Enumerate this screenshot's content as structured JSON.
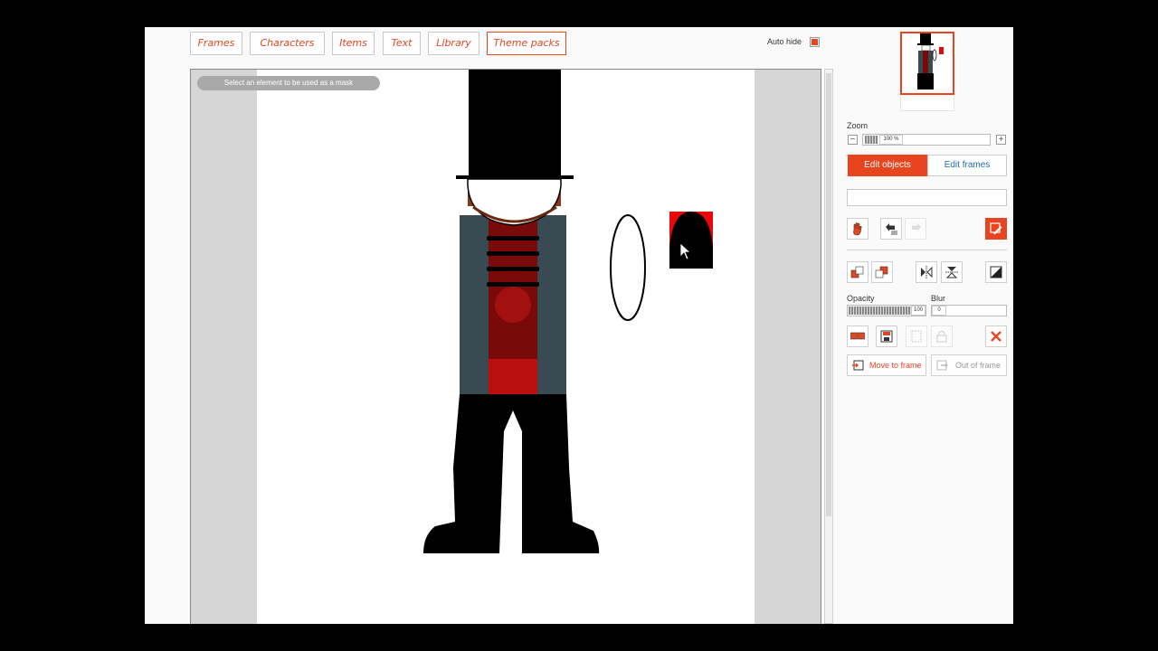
{
  "toolbar": {
    "tabs": [
      {
        "label": "Frames",
        "active": false
      },
      {
        "label": "Characters",
        "active": false
      },
      {
        "label": "Items",
        "active": false
      },
      {
        "label": "Text",
        "active": false
      },
      {
        "label": "Library",
        "active": false
      },
      {
        "label": "Theme packs",
        "active": true
      }
    ],
    "auto_hide_label": "Auto hide",
    "auto_hide_checked": true
  },
  "stage": {
    "hint": "Select an element to be used as a mask"
  },
  "panel": {
    "zoom_label": "Zoom",
    "zoom_value": "100 %",
    "edit_objects_label": "Edit objects",
    "edit_frames_label": "Edit frames",
    "object_name": "",
    "opacity_label": "Opacity",
    "opacity_value": "100",
    "blur_label": "Blur",
    "blur_value": "0",
    "move_to_frame_label": "Move to frame",
    "out_of_frame_label": "Out of frame"
  },
  "colors": {
    "accent": "#e8441f",
    "link": "#1b6fa8",
    "vest": "#3a4a53",
    "shirt": "#7a0a0a"
  }
}
